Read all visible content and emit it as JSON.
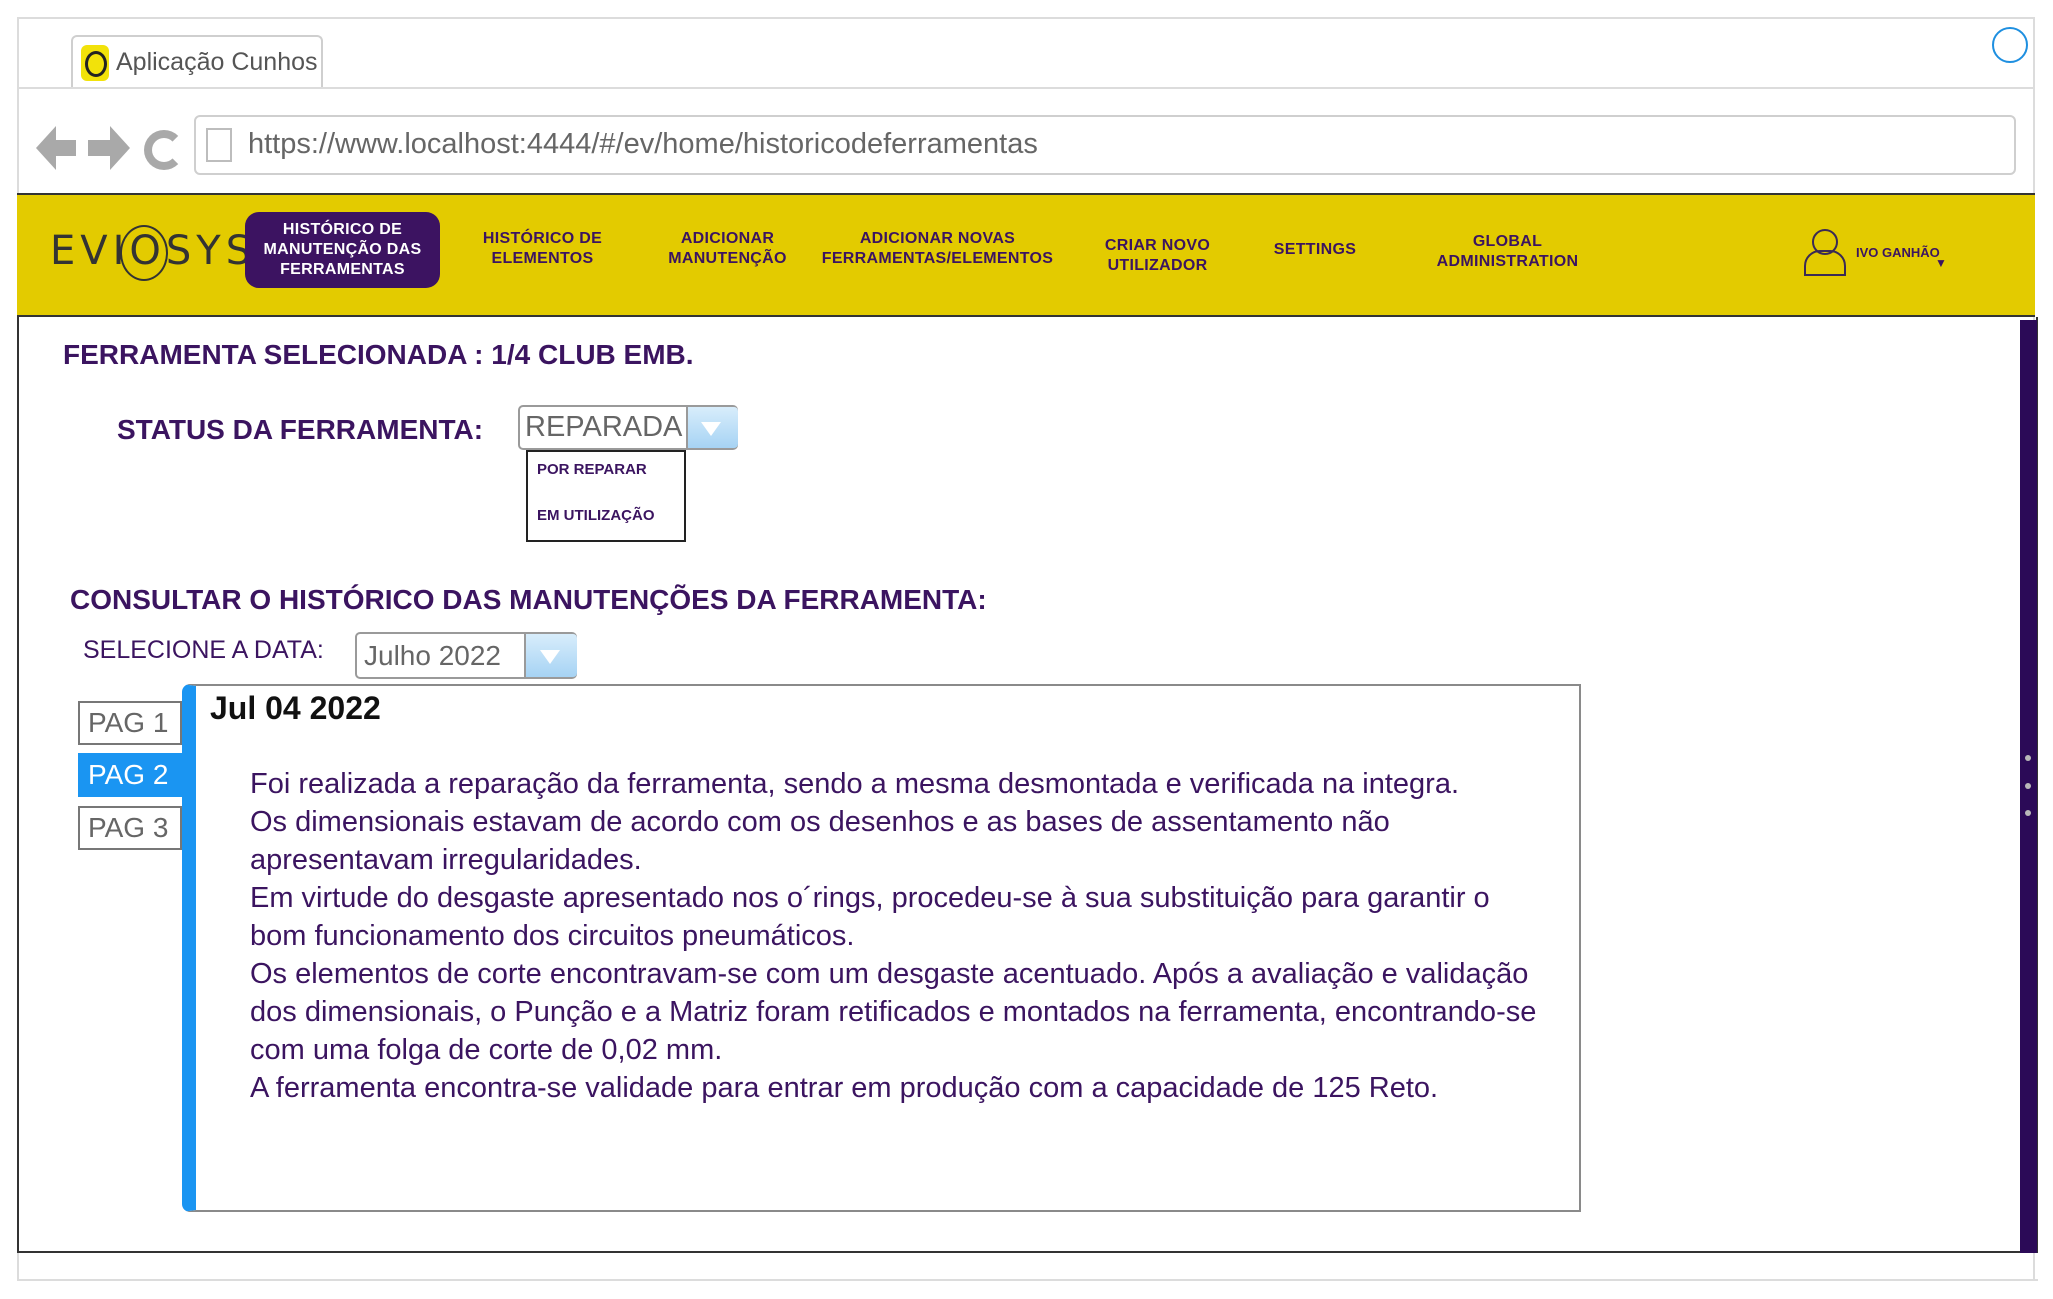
{
  "browser": {
    "tab_title": "Aplicação Cunhos",
    "url": "https://www.localhost:4444/#/ev/home/historicodeferramentas"
  },
  "header": {
    "logo": "EVIOSYS",
    "nav": [
      {
        "label": "HISTÓRICO DE\nMANUTENÇÃO DAS\nFERRAMENTAS",
        "active": true
      },
      {
        "label": "HISTÓRICO DE\nELEMENTOS",
        "active": false
      },
      {
        "label": "ADICIONAR\nMANUTENÇÃO",
        "active": false
      },
      {
        "label": "ADICIONAR NOVAS\nFERRAMENTAS/ELEMENTOS",
        "active": false
      },
      {
        "label": "CRIAR NOVO\nUTILIZADOR",
        "active": false
      },
      {
        "label": "SETTINGS",
        "active": false
      },
      {
        "label": "GLOBAL\nADMINISTRATION",
        "active": false
      }
    ],
    "user_name": "IVO GANHÃO",
    "user_caret": "▼"
  },
  "main": {
    "selected_tool": "FERRAMENTA SELECIONADA : 1/4 CLUB EMB.",
    "status_label": "STATUS DA FERRAMENTA:",
    "status_value": "REPARADA",
    "status_options": [
      "POR REPARAR",
      "EM UTILIZAÇÃO"
    ],
    "history_heading": "CONSULTAR O HISTÓRICO DAS MANUTENÇÕES  DA FERRAMENTA:",
    "date_label": "SELECIONE A DATA:",
    "date_value": "Julho 2022",
    "pages": [
      "PAG 1",
      "PAG 2",
      "PAG 3"
    ],
    "active_page": "PAG 2",
    "log": {
      "date": "Jul 04 2022",
      "paragraphs": [
        "Foi realizada a reparação da ferramenta, sendo a mesma desmontada e verificada na integra.",
        "Os dimensionais estavam de acordo com os desenhos e as bases de assentamento não apresentavam irregularidades.",
        "Em virtude do desgaste apresentado nos o´rings, procedeu-se à sua substituição para garantir o bom funcionamento dos circuitos pneumáticos.",
        "Os elementos de corte encontravam-se com um desgaste acentuado. Após a avaliação e validação dos dimensionais, o Punção e a Matriz foram retificados e montados na ferramenta, encontrando-se com uma folga de corte de 0,02 mm.",
        "A ferramenta encontra-se validade para entrar em produção com a capacidade de 125 Reto."
      ]
    }
  },
  "colors": {
    "header_bg": "#e3cb00",
    "brand_purple": "#3c1361",
    "accent_blue": "#1a95f2"
  }
}
